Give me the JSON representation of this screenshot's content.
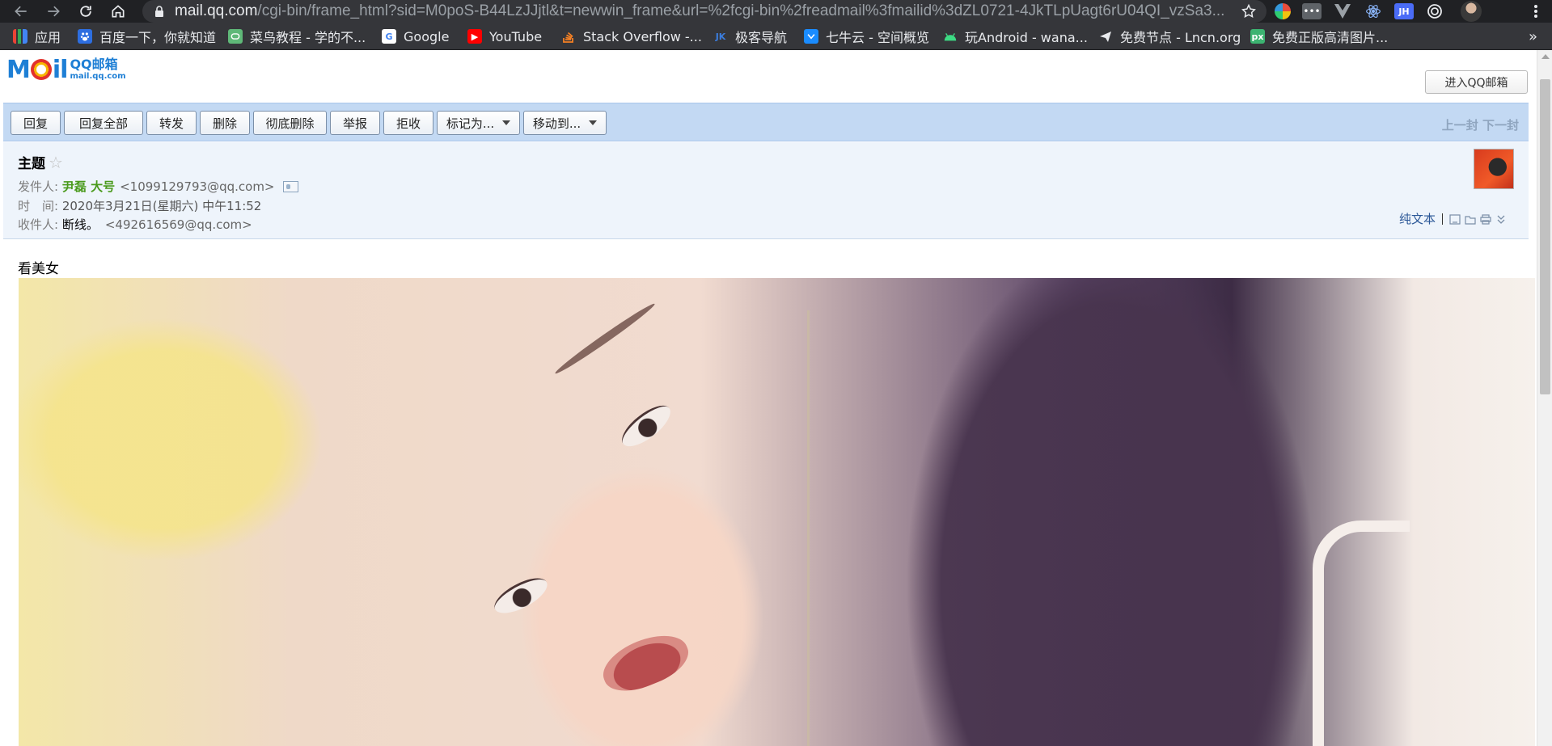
{
  "browser": {
    "url_host": "mail.qq.com",
    "url_path": "/cgi-bin/frame_html?sid=M0poS-B44LzJJjtl&t=newwin_frame&url=%2fcgi-bin%2freadmail%3fmailid%3dZL0721-4JkTLpUagt6rU04QI_vzSa3...",
    "extension_jh_label": "JH",
    "extension_dots_label": "•••"
  },
  "bookmarks": [
    {
      "label": "应用",
      "icon": "apps-grid-icon"
    },
    {
      "label": "百度一下，你就知道",
      "icon": "baidu-icon"
    },
    {
      "label": "菜鸟教程 - 学的不...",
      "icon": "runoob-icon"
    },
    {
      "label": "Google",
      "icon": "google-icon"
    },
    {
      "label": "YouTube",
      "icon": "youtube-icon"
    },
    {
      "label": "Stack Overflow -...",
      "icon": "stackoverflow-icon"
    },
    {
      "label": "极客导航",
      "icon": "jk-icon"
    },
    {
      "label": "七牛云 - 空间概览",
      "icon": "qiniu-icon"
    },
    {
      "label": "玩Android - wana...",
      "icon": "android-icon"
    },
    {
      "label": "免费节点 - Lncn.org",
      "icon": "paper-plane-icon"
    },
    {
      "label": "免费正版高清图片...",
      "icon": "px-icon"
    }
  ],
  "bookmark_icon_text": {
    "jk": "JK",
    "px": "px",
    "google": "G",
    "youtube": "▶"
  },
  "bookmarks_more": "»",
  "mail": {
    "logo_main": "M",
    "logo_rest": "il",
    "logo_cn": "QQ邮箱",
    "logo_domain": "mail.qq.com",
    "enter_button": "进入QQ邮箱",
    "toolbar": {
      "reply": "回复",
      "reply_all": "回复全部",
      "forward": "转发",
      "delete": "删除",
      "delete_forever": "彻底删除",
      "report": "举报",
      "reject": "拒收",
      "mark_as": "标记为...",
      "move_to": "移动到...",
      "pager": "上一封 下一封"
    },
    "subject_label": "主题",
    "star_glyph": "☆",
    "from_label": "发件人:",
    "from_name": "尹磊 大号",
    "from_email": "<1099129793@qq.com>",
    "time_label": "时　间:",
    "time_value": "2020年3月21日(星期六) 中午11:52",
    "to_label": "收件人:",
    "to_name": "断线。",
    "to_email": "<492616569@qq.com>",
    "plain_text": "纯文本",
    "body_text": "看美女"
  },
  "colors": {
    "toolbar_bg": "#c3d9f3",
    "info_bg": "#eef4fb",
    "sender_green": "#4a9a1c",
    "link_blue": "#2b5797"
  }
}
